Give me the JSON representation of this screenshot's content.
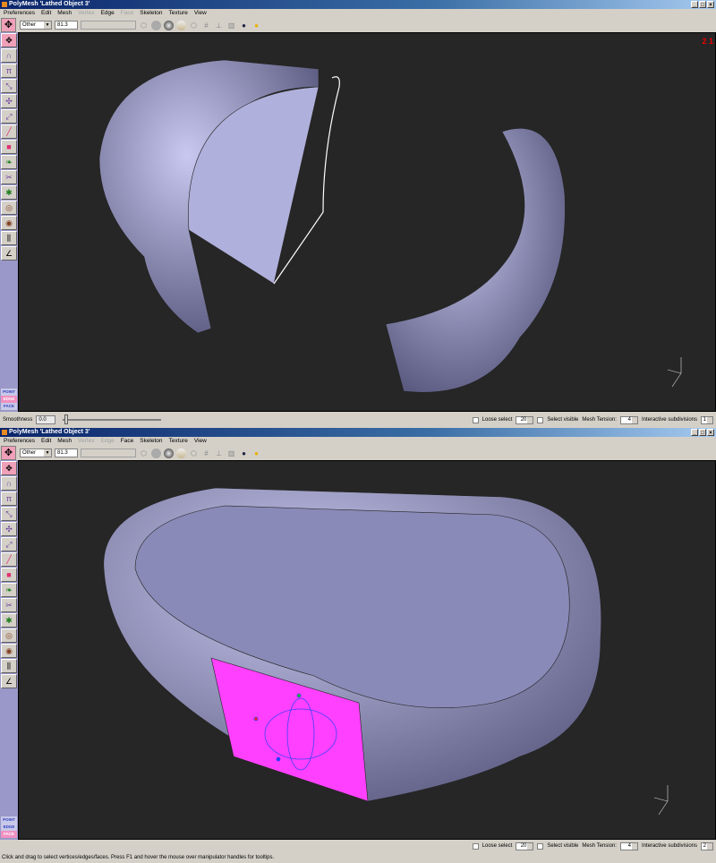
{
  "windows": [
    {
      "title": "PolyMesh 'Lathed Object 3'",
      "menu": [
        {
          "label": "Preferences",
          "enabled": true
        },
        {
          "label": "Edit",
          "enabled": true
        },
        {
          "label": "Mesh",
          "enabled": true
        },
        {
          "label": "Vertex",
          "enabled": false
        },
        {
          "label": "Edge",
          "enabled": true
        },
        {
          "label": "Face",
          "enabled": false
        },
        {
          "label": "Skeleton",
          "enabled": true
        },
        {
          "label": "Texture",
          "enabled": true
        },
        {
          "label": "View",
          "enabled": true
        }
      ],
      "toolbar": {
        "view_select": "Other",
        "zoom_value": "81.3"
      },
      "modes": {
        "point": "POINT",
        "edge": "EDGE",
        "face": "FACE",
        "active": "edge"
      },
      "viewport_label": "2 1",
      "bottom": {
        "smoothness_label": "Smoothness",
        "smoothness_value": "0.0",
        "loose_select_label": "Loose select",
        "loose_select_value": "20",
        "select_visible_label": "Select visible",
        "mesh_tension_label": "Mesh Tension:",
        "mesh_tension_value": "4",
        "subdiv_label": "Interactive subdivisions",
        "subdiv_value": "1"
      }
    },
    {
      "title": "PolyMesh 'Lathed Object 3'",
      "menu": [
        {
          "label": "Preferences",
          "enabled": true
        },
        {
          "label": "Edit",
          "enabled": true
        },
        {
          "label": "Mesh",
          "enabled": true
        },
        {
          "label": "Vertex",
          "enabled": false
        },
        {
          "label": "Edge",
          "enabled": false
        },
        {
          "label": "Face",
          "enabled": true
        },
        {
          "label": "Skeleton",
          "enabled": true
        },
        {
          "label": "Texture",
          "enabled": true
        },
        {
          "label": "View",
          "enabled": true
        }
      ],
      "toolbar": {
        "view_select": "Other",
        "zoom_value": "81.3"
      },
      "modes": {
        "point": "POINT",
        "edge": "EDGE",
        "face": "FACE",
        "active": "face"
      },
      "bottom": {
        "loose_select_label": "Loose select",
        "loose_select_value": "20",
        "select_visible_label": "Select visible",
        "mesh_tension_label": "Mesh Tension:",
        "mesh_tension_value": "4",
        "subdiv_label": "Interactive subdivisions",
        "subdiv_value": "2"
      },
      "status": "Click and drag to select vertices/edges/faces. Press F1 and hover the mouse over manipulator handles for tooltips."
    }
  ],
  "colors": {
    "mesh": "#a0a0d0",
    "selection": "#ff40ff",
    "viewport_bg": "#262626"
  }
}
